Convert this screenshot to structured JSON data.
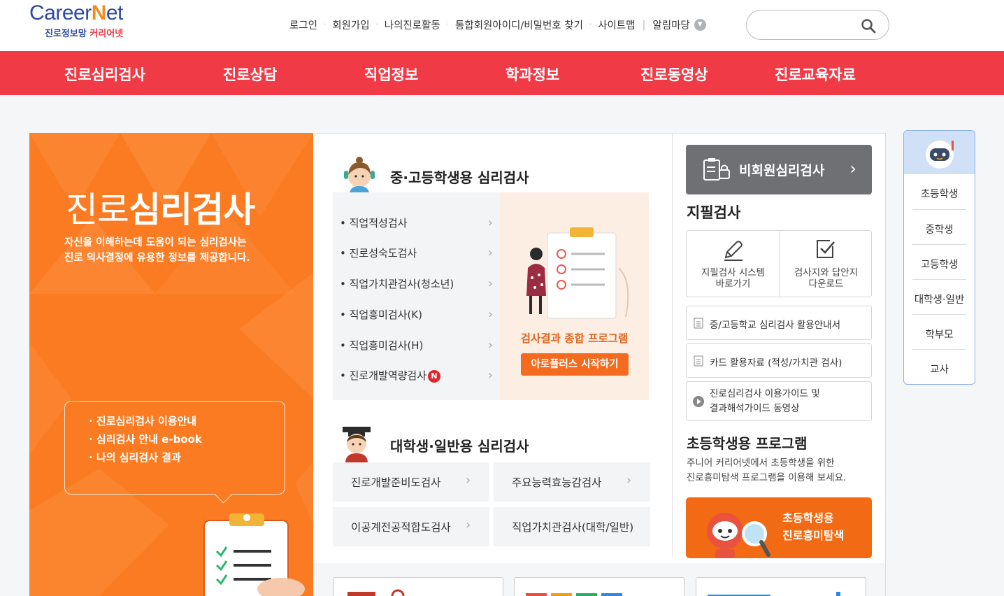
{
  "header": {
    "logo_main_a": "Career",
    "logo_main_n": "N",
    "logo_main_b": "et",
    "logo_sub_a": "진로정보망",
    "logo_sub_b": "커리어넷",
    "util": [
      "로그인",
      "회원가입",
      "나의진로활동",
      "통합회원아이디/비밀번호 찾기",
      "사이트맵",
      "알림마당"
    ],
    "search_placeholder": ""
  },
  "gnb": [
    "진로심리검사",
    "진로상담",
    "직업정보",
    "학과정보",
    "진로동영상",
    "진로교육자료"
  ],
  "hero": {
    "title_a": "진로",
    "title_b": "심리검사",
    "desc": [
      "자신을 이해하는데 도움이 되는 심리검사는",
      "진로 의사결정에 유용한 정보를 제공합니다."
    ],
    "links": [
      "· 진로심리검사 이용안내",
      "· 심리검사 안내 e-book",
      "· 나의 심리검사 결과"
    ]
  },
  "secondary": {
    "title": "중·고등학생용 심리검사",
    "items": [
      "• 직업적성검사",
      "• 진로성숙도검사",
      "• 직업가치관검사(청소년)",
      "• 직업흥미검사(K)",
      "• 직업흥미검사(H)",
      "• 진로개발역량검사"
    ],
    "new_badge": "N",
    "promo_title": "검사결과 종합 프로그램",
    "promo_button": "아로플러스 시작하기"
  },
  "university": {
    "title": "대학생·일반용 심리검사",
    "items": [
      "진로개발준비도검사",
      "주요능력효능감검사",
      "이공계전공적합도검사",
      "직업가치관검사(대학/일반)"
    ]
  },
  "right": {
    "guest_button": "비회원심리검사",
    "paper_title": "지필검사",
    "paper_cells": [
      [
        "지필검사 시스템",
        "바로가기"
      ],
      [
        "검사지와 답안지",
        "다운로드"
      ]
    ],
    "docs": [
      "중/고등학교 심리검사 활용안내서",
      "카드 활용자료 (적성/가치관 검사)"
    ],
    "video_guide": [
      "진로심리검사 이용가이드 및",
      "결과해석가이드 동영상"
    ],
    "elem_title": "초등학생용 프로그램",
    "elem_desc": [
      "주니어 커리어넷에서 초등학생을 위한",
      "진로흥미탐색 프로그램을 이용해 보세요."
    ],
    "elem_button": [
      "초등학생용",
      "진로흥미탐색"
    ]
  },
  "quick_menu": [
    "초등학생",
    "중학생",
    "고등학생",
    "대학생·일반",
    "학부모",
    "교사"
  ],
  "colors": {
    "brand_red": "#f03b47",
    "brand_orange": "#fb7b22",
    "logo_blue": "#2e4a9e"
  }
}
